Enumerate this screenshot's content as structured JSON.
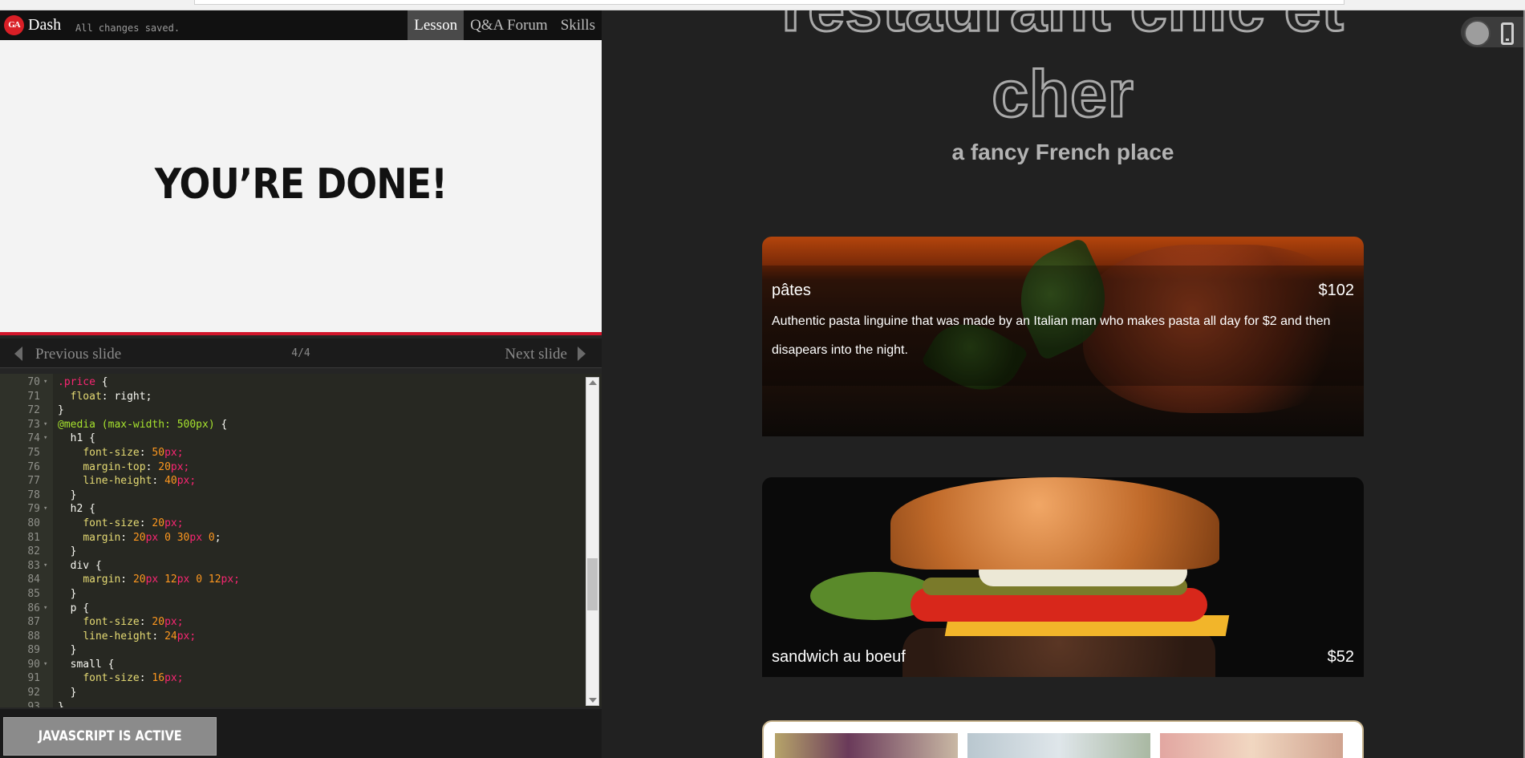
{
  "header": {
    "logo_text": "GA",
    "brand": "Dash",
    "save_status": "All changes saved.",
    "tabs": [
      {
        "label": "Lesson",
        "active": true
      },
      {
        "label": "Q&A Forum",
        "active": false
      },
      {
        "label": "Skills",
        "active": false
      }
    ]
  },
  "slide": {
    "heading": "YOU’RE DONE!",
    "accent_color": "#d2152b"
  },
  "slide_nav": {
    "prev_label": "Previous slide",
    "next_label": "Next slide",
    "counter": "4/4"
  },
  "editor": {
    "lines": [
      {
        "n": "70",
        "fold": true,
        "tokens": [
          {
            "t": ".price",
            "c": "sel"
          },
          {
            "t": " {",
            "c": ""
          }
        ]
      },
      {
        "n": "71",
        "fold": false,
        "tokens": [
          {
            "t": "  ",
            "c": ""
          },
          {
            "t": "float",
            "c": "prop"
          },
          {
            "t": ": right;",
            "c": ""
          }
        ]
      },
      {
        "n": "72",
        "fold": false,
        "tokens": [
          {
            "t": "}",
            "c": ""
          }
        ]
      },
      {
        "n": "73",
        "fold": true,
        "tokens": [
          {
            "t": "@media (max-width: 500px)",
            "c": "at"
          },
          {
            "t": " {",
            "c": ""
          }
        ]
      },
      {
        "n": "74",
        "fold": true,
        "tokens": [
          {
            "t": "  h1 {",
            "c": ""
          }
        ]
      },
      {
        "n": "75",
        "fold": false,
        "tokens": [
          {
            "t": "    ",
            "c": ""
          },
          {
            "t": "font-size",
            "c": "prop"
          },
          {
            "t": ": ",
            "c": ""
          },
          {
            "t": "50",
            "c": "num"
          },
          {
            "t": "px;",
            "c": "sel"
          }
        ]
      },
      {
        "n": "76",
        "fold": false,
        "tokens": [
          {
            "t": "    ",
            "c": ""
          },
          {
            "t": "margin-top",
            "c": "prop"
          },
          {
            "t": ": ",
            "c": ""
          },
          {
            "t": "20",
            "c": "num"
          },
          {
            "t": "px;",
            "c": "sel"
          }
        ]
      },
      {
        "n": "77",
        "fold": false,
        "tokens": [
          {
            "t": "    ",
            "c": ""
          },
          {
            "t": "line-height",
            "c": "prop"
          },
          {
            "t": ": ",
            "c": ""
          },
          {
            "t": "40",
            "c": "num"
          },
          {
            "t": "px;",
            "c": "sel"
          }
        ]
      },
      {
        "n": "78",
        "fold": false,
        "tokens": [
          {
            "t": "  }",
            "c": ""
          }
        ]
      },
      {
        "n": "79",
        "fold": true,
        "tokens": [
          {
            "t": "  h2 {",
            "c": ""
          }
        ]
      },
      {
        "n": "80",
        "fold": false,
        "tokens": [
          {
            "t": "    ",
            "c": ""
          },
          {
            "t": "font-size",
            "c": "prop"
          },
          {
            "t": ": ",
            "c": ""
          },
          {
            "t": "20",
            "c": "num"
          },
          {
            "t": "px;",
            "c": "sel"
          }
        ]
      },
      {
        "n": "81",
        "fold": false,
        "tokens": [
          {
            "t": "    ",
            "c": ""
          },
          {
            "t": "margin",
            "c": "prop"
          },
          {
            "t": ": ",
            "c": ""
          },
          {
            "t": "20",
            "c": "num"
          },
          {
            "t": "px ",
            "c": "sel"
          },
          {
            "t": "0 ",
            "c": "num"
          },
          {
            "t": "30",
            "c": "num"
          },
          {
            "t": "px ",
            "c": "sel"
          },
          {
            "t": "0",
            "c": "num"
          },
          {
            "t": ";",
            "c": ""
          }
        ]
      },
      {
        "n": "82",
        "fold": false,
        "tokens": [
          {
            "t": "  }",
            "c": ""
          }
        ]
      },
      {
        "n": "83",
        "fold": true,
        "tokens": [
          {
            "t": "  div {",
            "c": ""
          }
        ]
      },
      {
        "n": "84",
        "fold": false,
        "tokens": [
          {
            "t": "    ",
            "c": ""
          },
          {
            "t": "margin",
            "c": "prop"
          },
          {
            "t": ": ",
            "c": ""
          },
          {
            "t": "20",
            "c": "num"
          },
          {
            "t": "px ",
            "c": "sel"
          },
          {
            "t": "12",
            "c": "num"
          },
          {
            "t": "px ",
            "c": "sel"
          },
          {
            "t": "0 ",
            "c": "num"
          },
          {
            "t": "12",
            "c": "num"
          },
          {
            "t": "px;",
            "c": "sel"
          }
        ]
      },
      {
        "n": "85",
        "fold": false,
        "tokens": [
          {
            "t": "  }",
            "c": ""
          }
        ]
      },
      {
        "n": "86",
        "fold": true,
        "tokens": [
          {
            "t": "  p {",
            "c": ""
          }
        ]
      },
      {
        "n": "87",
        "fold": false,
        "tokens": [
          {
            "t": "    ",
            "c": ""
          },
          {
            "t": "font-size",
            "c": "prop"
          },
          {
            "t": ": ",
            "c": ""
          },
          {
            "t": "20",
            "c": "num"
          },
          {
            "t": "px;",
            "c": "sel"
          }
        ]
      },
      {
        "n": "88",
        "fold": false,
        "tokens": [
          {
            "t": "    ",
            "c": ""
          },
          {
            "t": "line-height",
            "c": "prop"
          },
          {
            "t": ": ",
            "c": ""
          },
          {
            "t": "24",
            "c": "num"
          },
          {
            "t": "px;",
            "c": "sel"
          }
        ]
      },
      {
        "n": "89",
        "fold": false,
        "tokens": [
          {
            "t": "  }",
            "c": ""
          }
        ]
      },
      {
        "n": "90",
        "fold": true,
        "tokens": [
          {
            "t": "  small {",
            "c": ""
          }
        ]
      },
      {
        "n": "91",
        "fold": false,
        "tokens": [
          {
            "t": "    ",
            "c": ""
          },
          {
            "t": "font-size",
            "c": "prop"
          },
          {
            "t": ": ",
            "c": ""
          },
          {
            "t": "16",
            "c": "num"
          },
          {
            "t": "px;",
            "c": "sel"
          }
        ]
      },
      {
        "n": "92",
        "fold": false,
        "tokens": [
          {
            "t": "  }",
            "c": ""
          }
        ]
      },
      {
        "n": "93",
        "fold": false,
        "tokens": [
          {
            "t": "}",
            "c": ""
          }
        ]
      }
    ]
  },
  "js_status": "JAVASCRIPT IS ACTIVE",
  "preview": {
    "title_line1": "restaurant chic et",
    "title_line2": "cher",
    "subtitle": "a fancy French place",
    "menu": [
      {
        "name": "pâtes",
        "price": "$102",
        "description": "Authentic pasta linguine that was made by an Italian man who makes pasta all day for $2 and then disapears into the night."
      },
      {
        "name": "sandwich au boeuf",
        "price": "$52"
      }
    ]
  },
  "icons": {
    "logo": "ga-logo-icon",
    "prev": "chevron-left-icon",
    "next": "chevron-right-icon",
    "toggle": "view-toggle-icon",
    "phone": "mobile-phone-icon"
  }
}
